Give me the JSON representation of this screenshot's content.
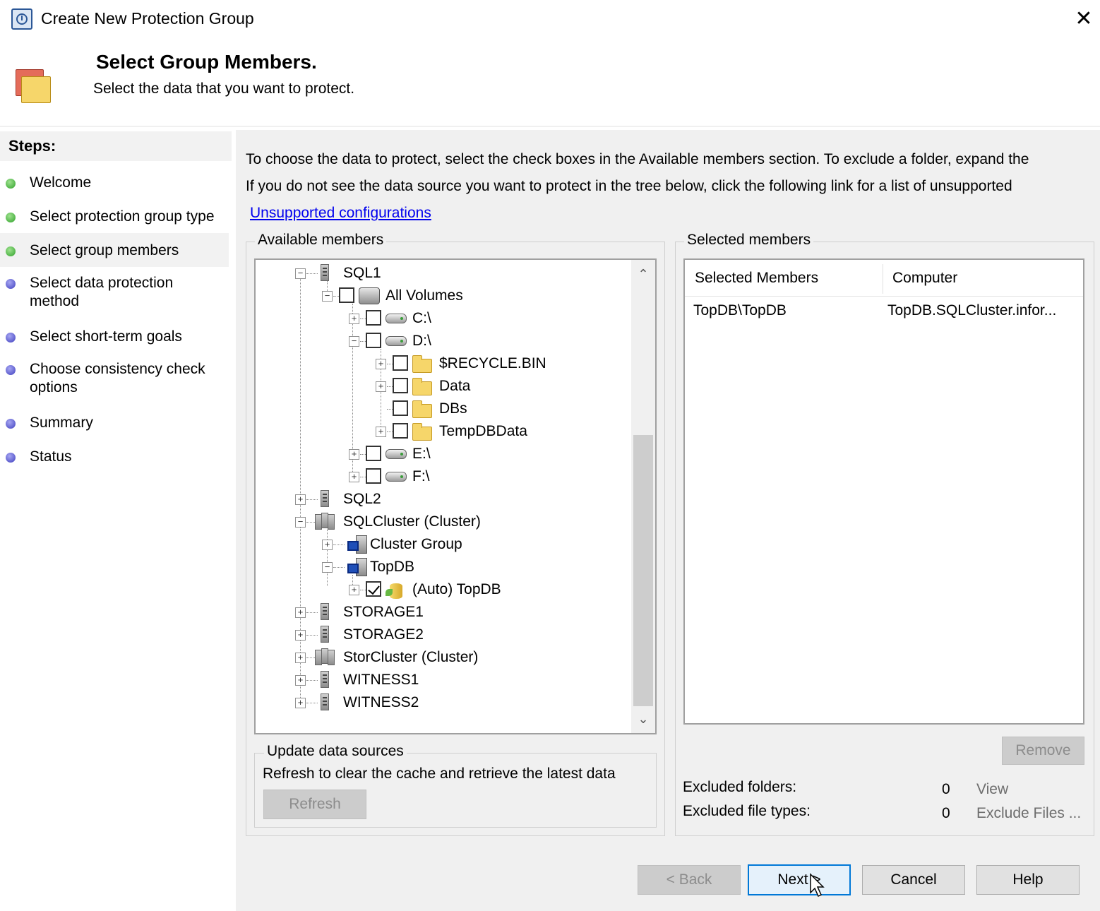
{
  "window": {
    "title": "Create New Protection Group",
    "close_glyph": "✕"
  },
  "header": {
    "title": "Select Group Members.",
    "subtitle": "Select the data that you want to protect."
  },
  "steps": {
    "heading": "Steps:",
    "items": [
      {
        "label": "Welcome",
        "status": "done"
      },
      {
        "label": "Select protection group type",
        "status": "done"
      },
      {
        "label": "Select group members",
        "status": "current"
      },
      {
        "label": "Select data protection method",
        "status": "pending"
      },
      {
        "label": "Select short-term goals",
        "status": "pending"
      },
      {
        "label": "Choose consistency check options",
        "status": "pending"
      },
      {
        "label": "Summary",
        "status": "pending"
      },
      {
        "label": "Status",
        "status": "pending"
      }
    ]
  },
  "intro": {
    "line1": "To choose the data to protect, select the check boxes in the Available members section. To exclude a folder, expand the",
    "line2": "If you do not see the data source you want to protect in the tree below, click the following link for a list of unsupported",
    "link": "Unsupported configurations"
  },
  "available": {
    "label": "Available members",
    "tree": [
      {
        "label": "SQL1",
        "icon": "server-icon",
        "level": 0,
        "expander": "minus",
        "checkbox": null
      },
      {
        "label": "All Volumes",
        "icon": "volumes-icon",
        "level": 1,
        "expander": "minus",
        "checkbox": false
      },
      {
        "label": "C:\\",
        "icon": "drive-icon",
        "level": 2,
        "expander": "plus",
        "checkbox": false
      },
      {
        "label": "D:\\",
        "icon": "drive-icon",
        "level": 2,
        "expander": "minus",
        "checkbox": false
      },
      {
        "label": "$RECYCLE.BIN",
        "icon": "folder-icon",
        "level": 3,
        "expander": "plus",
        "checkbox": false
      },
      {
        "label": "Data",
        "icon": "folder-icon",
        "level": 3,
        "expander": "plus",
        "checkbox": false
      },
      {
        "label": "DBs",
        "icon": "folder-icon",
        "level": 3,
        "expander": "none",
        "checkbox": false
      },
      {
        "label": "TempDBData",
        "icon": "folder-icon",
        "level": 3,
        "expander": "plus",
        "checkbox": false
      },
      {
        "label": "E:\\",
        "icon": "drive-icon",
        "level": 2,
        "expander": "plus",
        "checkbox": false
      },
      {
        "label": "F:\\",
        "icon": "drive-icon",
        "level": 2,
        "expander": "plus",
        "checkbox": false
      },
      {
        "label": "SQL2",
        "icon": "server-icon",
        "level": 0,
        "expander": "plus",
        "checkbox": null
      },
      {
        "label": "SQLCluster (Cluster)",
        "icon": "cluster-icon",
        "level": 0,
        "expander": "minus",
        "checkbox": null
      },
      {
        "label": "Cluster Group",
        "icon": "cluster-group-icon",
        "level": 1,
        "expander": "plus",
        "checkbox": null
      },
      {
        "label": "TopDB",
        "icon": "cluster-group-icon",
        "level": 1,
        "expander": "minus",
        "checkbox": null
      },
      {
        "label": "(Auto) TopDB",
        "icon": "database-icon",
        "level": 2,
        "expander": "plus",
        "checkbox": true
      },
      {
        "label": "STORAGE1",
        "icon": "server-icon",
        "level": 0,
        "expander": "plus",
        "checkbox": null
      },
      {
        "label": "STORAGE2",
        "icon": "server-icon",
        "level": 0,
        "expander": "plus",
        "checkbox": null
      },
      {
        "label": "StorCluster (Cluster)",
        "icon": "cluster-icon",
        "level": 0,
        "expander": "plus",
        "checkbox": null
      },
      {
        "label": "WITNESS1",
        "icon": "server-icon",
        "level": 0,
        "expander": "plus",
        "checkbox": null
      },
      {
        "label": "WITNESS2",
        "icon": "server-icon",
        "level": 0,
        "expander": "plus",
        "checkbox": null
      }
    ]
  },
  "update": {
    "label": "Update data sources",
    "text": "Refresh to clear the cache and retrieve the latest data",
    "refresh_label": "Refresh"
  },
  "selected": {
    "label": "Selected members",
    "columns": [
      "Selected Members",
      "Computer"
    ],
    "rows": [
      {
        "member": "TopDB\\TopDB",
        "computer": "TopDB.SQLCluster.infor..."
      }
    ],
    "remove_label": "Remove",
    "excluded_folders_label": "Excluded folders:",
    "excluded_folders_count": "0",
    "view_label": "View",
    "excluded_types_label": "Excluded file types:",
    "excluded_types_count": "0",
    "exclude_files_label": "Exclude Files ..."
  },
  "footer": {
    "back": "< Back",
    "next": "Next >",
    "cancel": "Cancel",
    "help": "Help"
  },
  "colors": {
    "step_done": "#2fa12a",
    "step_pending": "#3f3fbf",
    "link": "#0000ee",
    "focus": "#0078d7"
  }
}
